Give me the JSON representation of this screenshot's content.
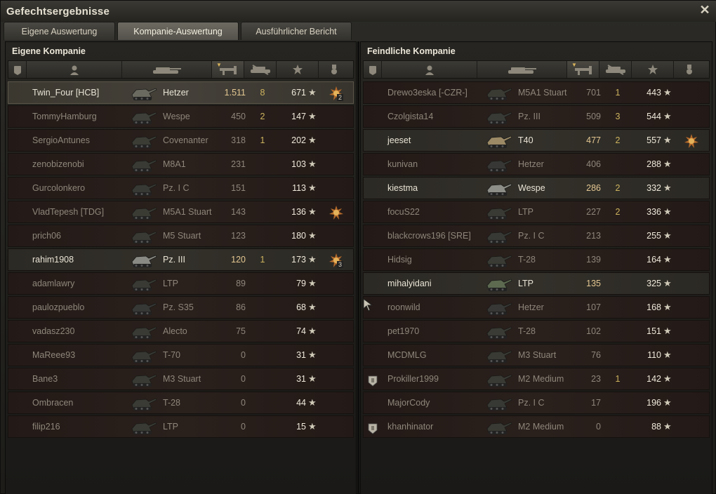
{
  "window": {
    "title": "Gefechtsergebnisse",
    "close_label": "✕"
  },
  "tabs": [
    {
      "label": "Eigene Auswertung",
      "active": false
    },
    {
      "label": "Kompanie-Auswertung",
      "active": true
    },
    {
      "label": "Ausführlicher Bericht",
      "active": false
    }
  ],
  "columns_icons": [
    "squad-icon",
    "player-icon",
    "tank-icon",
    "damage-icon",
    "kills-icon",
    "xp-star-icon",
    "medal-icon"
  ],
  "own": {
    "title": "Eigene Kompanie",
    "rows": [
      {
        "name": "Twin_Four [HCB]",
        "tank": "Hetzer",
        "damage": "1.511",
        "kills": "8",
        "xp": "671",
        "state": "self",
        "medal": true,
        "medal_count": "2",
        "tank_color": "#6b6a60"
      },
      {
        "name": "TommyHamburg",
        "tank": "Wespe",
        "damage": "450",
        "kills": "2",
        "xp": "147",
        "state": "dead",
        "medal": false,
        "medal_count": "",
        "tank_color": "#3d3f38"
      },
      {
        "name": "SergioAntunes",
        "tank": "Covenanter",
        "damage": "318",
        "kills": "1",
        "xp": "202",
        "state": "dead",
        "medal": false,
        "medal_count": "",
        "tank_color": "#3b3d35"
      },
      {
        "name": "zenobizenobi",
        "tank": "M8A1",
        "damage": "231",
        "kills": "",
        "xp": "103",
        "state": "dead",
        "medal": false,
        "medal_count": "",
        "tank_color": "#383a33"
      },
      {
        "name": "Gurcolonkero",
        "tank": "Pz. I C",
        "damage": "151",
        "kills": "",
        "xp": "113",
        "state": "dead",
        "medal": false,
        "medal_count": "",
        "tank_color": "#373934"
      },
      {
        "name": "VladTepesh [TDG]",
        "tank": "M5A1 Stuart",
        "damage": "143",
        "kills": "",
        "xp": "136",
        "state": "dead",
        "medal": true,
        "medal_count": "",
        "tank_color": "#3a3c34"
      },
      {
        "name": "prich06",
        "tank": "M5 Stuart",
        "damage": "123",
        "kills": "",
        "xp": "180",
        "state": "dead",
        "medal": false,
        "medal_count": "",
        "tank_color": "#393a33"
      },
      {
        "name": "rahim1908",
        "tank": "Pz. III",
        "damage": "120",
        "kills": "1",
        "xp": "173",
        "state": "alive",
        "medal": true,
        "medal_count": "3",
        "tank_color": "#8a8a84"
      },
      {
        "name": "adamlawry",
        "tank": "LTP",
        "damage": "89",
        "kills": "",
        "xp": "79",
        "state": "dead",
        "medal": false,
        "medal_count": "",
        "tank_color": "#383a33"
      },
      {
        "name": "paulozpueblo",
        "tank": "Pz. S35",
        "damage": "86",
        "kills": "",
        "xp": "68",
        "state": "dead",
        "medal": false,
        "medal_count": "",
        "tank_color": "#363836"
      },
      {
        "name": "vadasz230",
        "tank": "Alecto",
        "damage": "75",
        "kills": "",
        "xp": "74",
        "state": "dead",
        "medal": false,
        "medal_count": "",
        "tank_color": "#383a33"
      },
      {
        "name": "MaReee93",
        "tank": "T-70",
        "damage": "0",
        "kills": "",
        "xp": "31",
        "state": "dead",
        "medal": false,
        "medal_count": "",
        "tank_color": "#373833"
      },
      {
        "name": "Bane3",
        "tank": "M3 Stuart",
        "damage": "0",
        "kills": "",
        "xp": "31",
        "state": "dead",
        "medal": false,
        "medal_count": "",
        "tank_color": "#383a33"
      },
      {
        "name": "Ombracen",
        "tank": "T-28",
        "damage": "0",
        "kills": "",
        "xp": "44",
        "state": "dead",
        "medal": false,
        "medal_count": "",
        "tank_color": "#393b34"
      },
      {
        "name": "filip216",
        "tank": "LTP",
        "damage": "0",
        "kills": "",
        "xp": "15",
        "state": "dead",
        "medal": false,
        "medal_count": "",
        "tank_color": "#383a33"
      }
    ]
  },
  "enemy": {
    "title": "Feindliche Kompanie",
    "rows": [
      {
        "name": "Drewo3eska [-CZR-]",
        "tank": "M5A1 Stuart",
        "damage": "701",
        "kills": "1",
        "xp": "443",
        "state": "dead",
        "medal": false,
        "squad": false,
        "tank_color": "#3a3c34"
      },
      {
        "name": "Czolgista14",
        "tank": "Pz. III",
        "damage": "509",
        "kills": "3",
        "xp": "544",
        "state": "dead",
        "medal": false,
        "squad": false,
        "tank_color": "#383a36"
      },
      {
        "name": "jeeset",
        "tank": "T40",
        "damage": "477",
        "kills": "2",
        "xp": "557",
        "state": "alive",
        "medal": true,
        "squad": false,
        "tank_color": "#9c8a66"
      },
      {
        "name": "kunivan",
        "tank": "Hetzer",
        "damage": "406",
        "kills": "",
        "xp": "288",
        "state": "dead",
        "medal": false,
        "squad": false,
        "tank_color": "#373835"
      },
      {
        "name": "kiestma",
        "tank": "Wespe",
        "damage": "286",
        "kills": "2",
        "xp": "332",
        "state": "alive",
        "medal": false,
        "squad": false,
        "tank_color": "#8e8e88"
      },
      {
        "name": "focuS22",
        "tank": "LTP",
        "damage": "227",
        "kills": "2",
        "xp": "336",
        "state": "dead",
        "medal": false,
        "squad": false,
        "tank_color": "#383a33"
      },
      {
        "name": "blackcrows196 [SRE]",
        "tank": "Pz. I C",
        "damage": "213",
        "kills": "",
        "xp": "255",
        "state": "dead",
        "medal": false,
        "squad": false,
        "tank_color": "#373934"
      },
      {
        "name": "Hidsig",
        "tank": "T-28",
        "damage": "139",
        "kills": "",
        "xp": "164",
        "state": "dead",
        "medal": false,
        "squad": false,
        "tank_color": "#393b34"
      },
      {
        "name": "mihalyidani",
        "tank": "LTP",
        "damage": "135",
        "kills": "",
        "xp": "325",
        "state": "alive",
        "medal": false,
        "squad": false,
        "tank_color": "#5d6a50"
      },
      {
        "name": "roonwild",
        "tank": "Hetzer",
        "damage": "107",
        "kills": "",
        "xp": "168",
        "state": "dead",
        "medal": false,
        "squad": false,
        "tank_color": "#373835"
      },
      {
        "name": "pet1970",
        "tank": "T-28",
        "damage": "102",
        "kills": "",
        "xp": "151",
        "state": "dead",
        "medal": false,
        "squad": false,
        "tank_color": "#393b34"
      },
      {
        "name": "MCDMLG",
        "tank": "M3 Stuart",
        "damage": "76",
        "kills": "",
        "xp": "110",
        "state": "dead",
        "medal": false,
        "squad": false,
        "tank_color": "#383a33"
      },
      {
        "name": "Prokiller1999",
        "tank": "M2 Medium",
        "damage": "23",
        "kills": "1",
        "xp": "142",
        "state": "dead",
        "medal": false,
        "squad": true,
        "tank_color": "#393a33"
      },
      {
        "name": "MajorCody",
        "tank": "Pz. I C",
        "damage": "17",
        "kills": "",
        "xp": "196",
        "state": "dead",
        "medal": false,
        "squad": false,
        "tank_color": "#373934"
      },
      {
        "name": "khanhinator",
        "tank": "M2 Medium",
        "damage": "0",
        "kills": "",
        "xp": "88",
        "state": "dead",
        "medal": false,
        "squad": true,
        "tank_color": "#393a33"
      }
    ]
  },
  "star_glyph": "★"
}
